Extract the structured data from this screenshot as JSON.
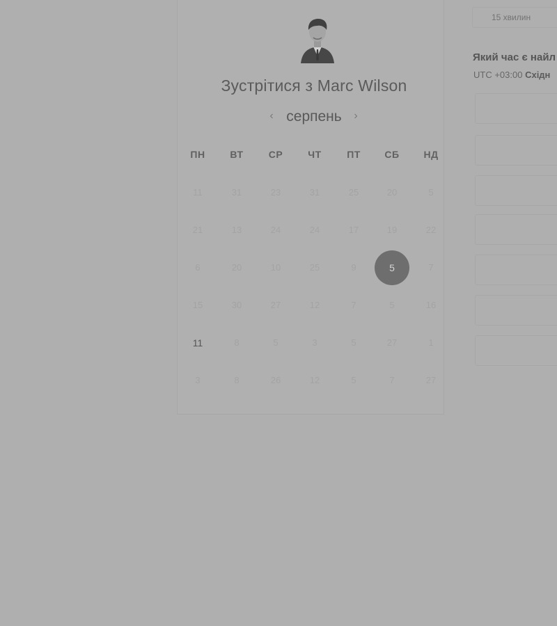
{
  "booking": {
    "title": "Зустрітися з Marc Wilson",
    "month": "серпень",
    "weekdays": [
      "ПН",
      "ВТ",
      "СР",
      "ЧТ",
      "ПТ",
      "СБ",
      "НД"
    ],
    "weeks": [
      [
        "11",
        "31",
        "23",
        "31",
        "25",
        "20",
        "5"
      ],
      [
        "21",
        "13",
        "24",
        "24",
        "17",
        "19",
        "22"
      ],
      [
        "6",
        "20",
        "10",
        "25",
        "9",
        "5",
        "7"
      ],
      [
        "15",
        "30",
        "27",
        "12",
        "7",
        "5",
        "16"
      ],
      [
        "11",
        "8",
        "5",
        "3",
        "5",
        "27",
        "1"
      ],
      [
        "3",
        "8",
        "26",
        "12",
        "5",
        "7",
        "27"
      ]
    ],
    "selected_day": "5",
    "available_day": "11"
  },
  "right_pane": {
    "duration": "15 хвилин",
    "question": "Який час є найл",
    "timezone_offset": "UTC +03:00",
    "timezone_name": "Східн",
    "slot_count": 7
  },
  "icons": {
    "prev": "chevron-left-icon",
    "next": "chevron-right-icon"
  },
  "colors": {
    "background": "#afafaf",
    "selected_day": "#6e6e6e"
  }
}
